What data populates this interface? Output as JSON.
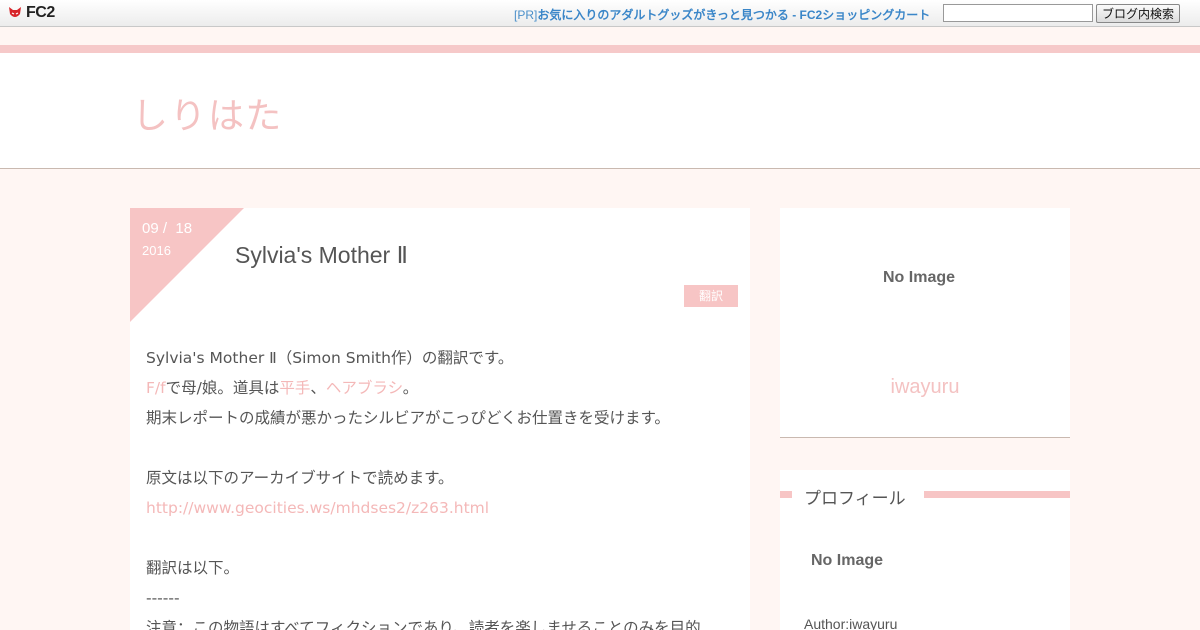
{
  "fc2bar": {
    "logo_text": "FC2",
    "pr_tag": "[PR]",
    "pr_link": "お気に入りのアダルトグッズがきっと見つかる - FC2ショッピングカート",
    "search_placeholder": "",
    "search_button": "ブログ内検索"
  },
  "header": {
    "site_title": "しりはた"
  },
  "article": {
    "date_month": "09 /",
    "date_day": "18",
    "date_year": "2016",
    "title": "Sylvia's Mother Ⅱ",
    "category": "翻訳",
    "lines": {
      "l1": "Sylvia's Mother Ⅱ（Simon Smith作）の翻訳です。",
      "l2_a": "F/f",
      "l2_b": "で母/娘。道具は",
      "l2_c": "平手",
      "l2_d": "、",
      "l2_e": "ヘアブラシ",
      "l2_f": "。",
      "l3": "期末レポートの成績が悪かったシルビアがこっぴどくお仕置きを受けます。",
      "l5": "原文は以下のアーカイブサイトで読めます。",
      "l6": "http://www.geocities.ws/mhdses2/z263.html",
      "l8": "翻訳は以下。",
      "l9": "------",
      "l10": "注意：この物語はすべてフィクションであり、読者を楽しませることのみを目的"
    }
  },
  "sidebar": {
    "card_noimage": "No Image",
    "card_name": "iwayuru",
    "profile_title": "プロフィール",
    "profile_noimage": "No Image",
    "author": "Author:iwayuru"
  },
  "colors": {
    "accent_pink": "#f7c5c5",
    "text_pink": "#f4c2c2",
    "link_blue": "#3a86c8",
    "background": "#fff6f3"
  }
}
